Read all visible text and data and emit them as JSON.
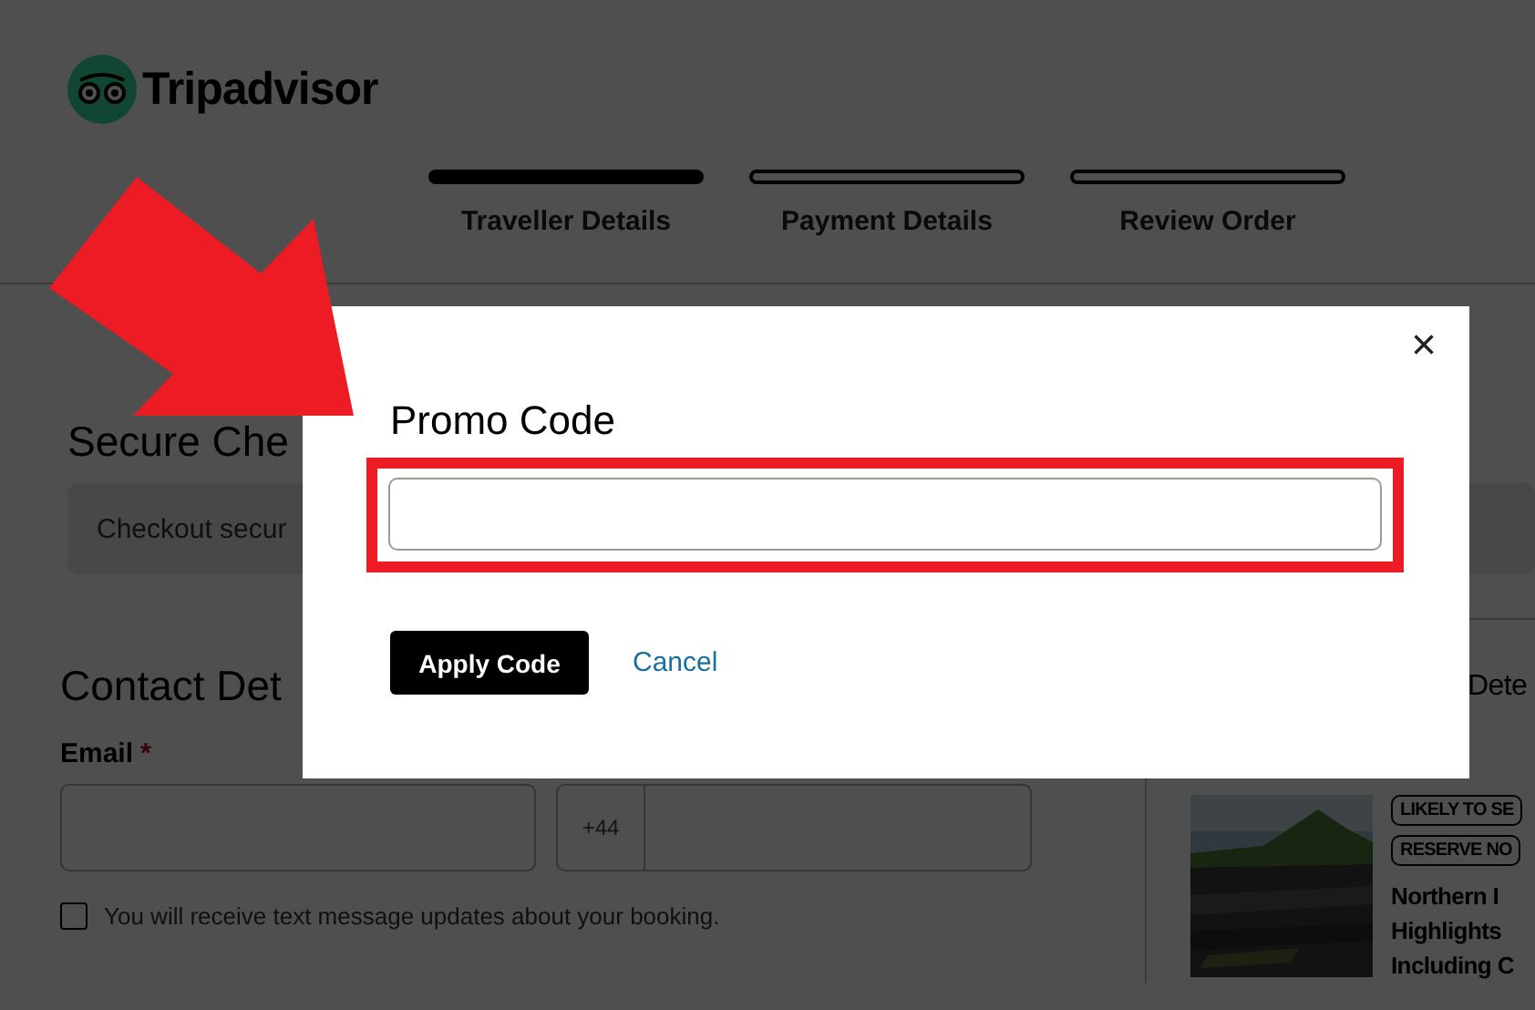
{
  "header": {
    "logo": "Tripadvisor"
  },
  "steps": [
    {
      "label": "Traveller Details",
      "selected": true
    },
    {
      "label": "Payment Details",
      "selected": false
    },
    {
      "label": "Review Order",
      "selected": false
    }
  ],
  "checkout": {
    "secure_heading": "Secure Che",
    "secure_notice": "Checkout secur",
    "contact_heading": "Contact Det",
    "email_label": "Email",
    "required_mark": "*",
    "phone_prefix": "+44",
    "sms_checkbox": {
      "label": "You will receive text message updates about your booking.",
      "checked": false
    }
  },
  "summary": {
    "heading": "Dete",
    "tags": [
      "LIKELY TO SE",
      "RESERVE NO"
    ],
    "title_lines": [
      "Northern I",
      "Highlights",
      "Including C"
    ]
  },
  "modal": {
    "close": "×",
    "title": "Promo Code",
    "apply_button": "Apply Code",
    "cancel_link": "Cancel"
  }
}
